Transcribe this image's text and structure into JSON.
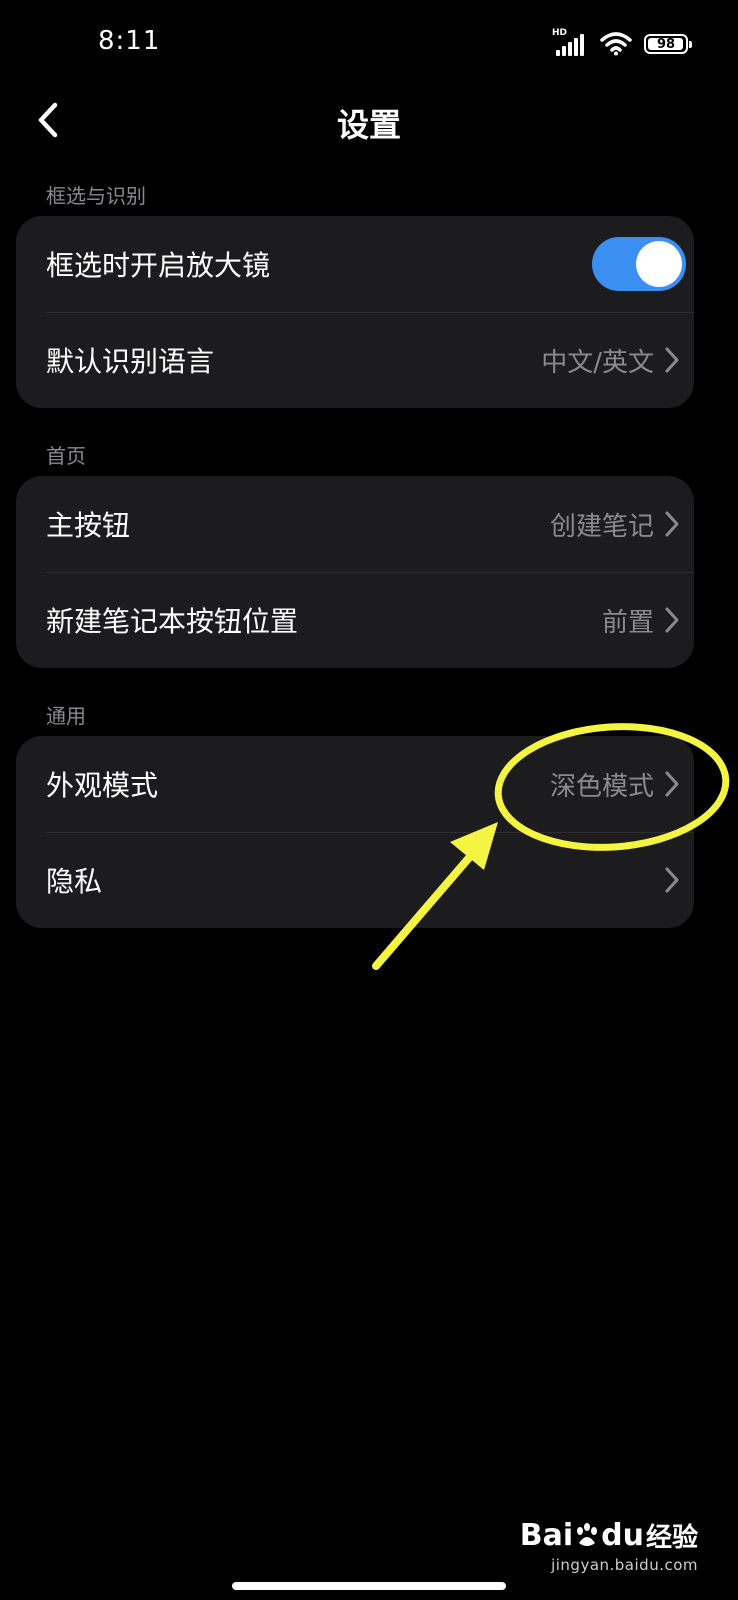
{
  "status_bar": {
    "time": "8:11",
    "network_label": "HD",
    "battery_level": "98",
    "battery_fraction": 0.98
  },
  "nav": {
    "title": "设置",
    "back_icon": "chevron-left-icon"
  },
  "sections": [
    {
      "label": "框选与识别",
      "rows": [
        {
          "label": "框选时开启放大镜",
          "type": "toggle",
          "on": true
        },
        {
          "label": "默认识别语言",
          "value": "中文/英文",
          "type": "disclosure"
        }
      ]
    },
    {
      "label": "首页",
      "rows": [
        {
          "label": "主按钮",
          "value": "创建笔记",
          "type": "disclosure"
        },
        {
          "label": "新建笔记本按钮位置",
          "value": "前置",
          "type": "disclosure"
        }
      ]
    },
    {
      "label": "通用",
      "rows": [
        {
          "label": "外观模式",
          "value": "深色模式",
          "type": "disclosure"
        },
        {
          "label": "隐私",
          "value": "",
          "type": "disclosure"
        }
      ]
    }
  ],
  "watermark": {
    "logo_text": "Bai",
    "logo_text_2": "du",
    "logo_suffix": "经验",
    "url": "jingyan.baidu.com"
  },
  "colors": {
    "background": "#000000",
    "card": "#1c1c1e",
    "toggle_on": "#3b8ff2",
    "secondary_text": "#8a8a8e",
    "annotation": "#f4f442"
  }
}
